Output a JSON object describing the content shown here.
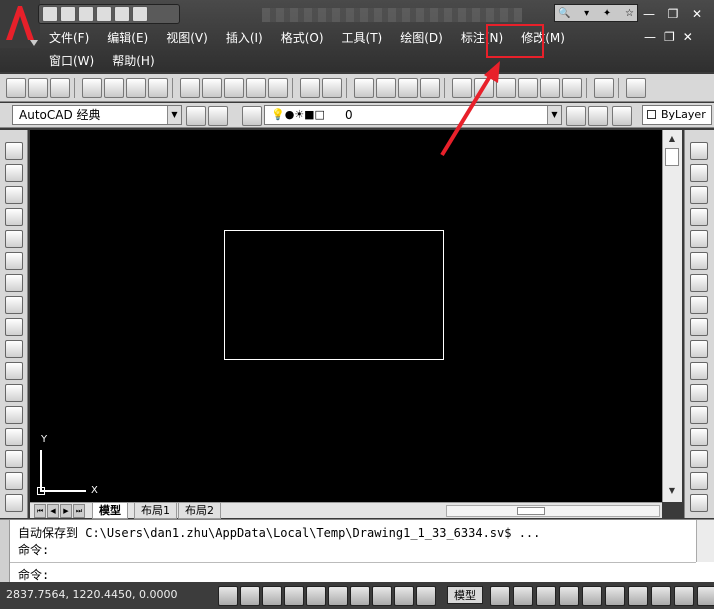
{
  "app": {
    "name": "AutoCAD",
    "logo_letter": "A",
    "accent": "#e8202a"
  },
  "search": {
    "placeholder": ""
  },
  "menu": {
    "row1": [
      "文件(F)",
      "编辑(E)",
      "视图(V)",
      "插入(I)",
      "格式(O)",
      "工具(T)",
      "绘图(D)",
      "标注(N)",
      "修改(M)"
    ],
    "row2": [
      "窗口(W)",
      "帮助(H)"
    ],
    "highlighted": "标注(N)"
  },
  "toolbar2": {
    "workspace": "AutoCAD 经典",
    "layer_value": "0",
    "color_value": "ByLayer"
  },
  "ucs": {
    "x_label": "X",
    "y_label": "Y"
  },
  "tabs": [
    "模型",
    "布局1",
    "布局2"
  ],
  "command": {
    "history1": "自动保存到 C:\\Users\\dan1.zhu\\AppData\\Local\\Temp\\Drawing1_1_33_6334.sv$ ...",
    "history2": "命令:",
    "prompt": "命令:"
  },
  "status": {
    "coordinates": "2837.7564, 1220.4450, 0.0000",
    "model_button": "模型"
  },
  "annotation": {
    "color": "#e8202a"
  }
}
